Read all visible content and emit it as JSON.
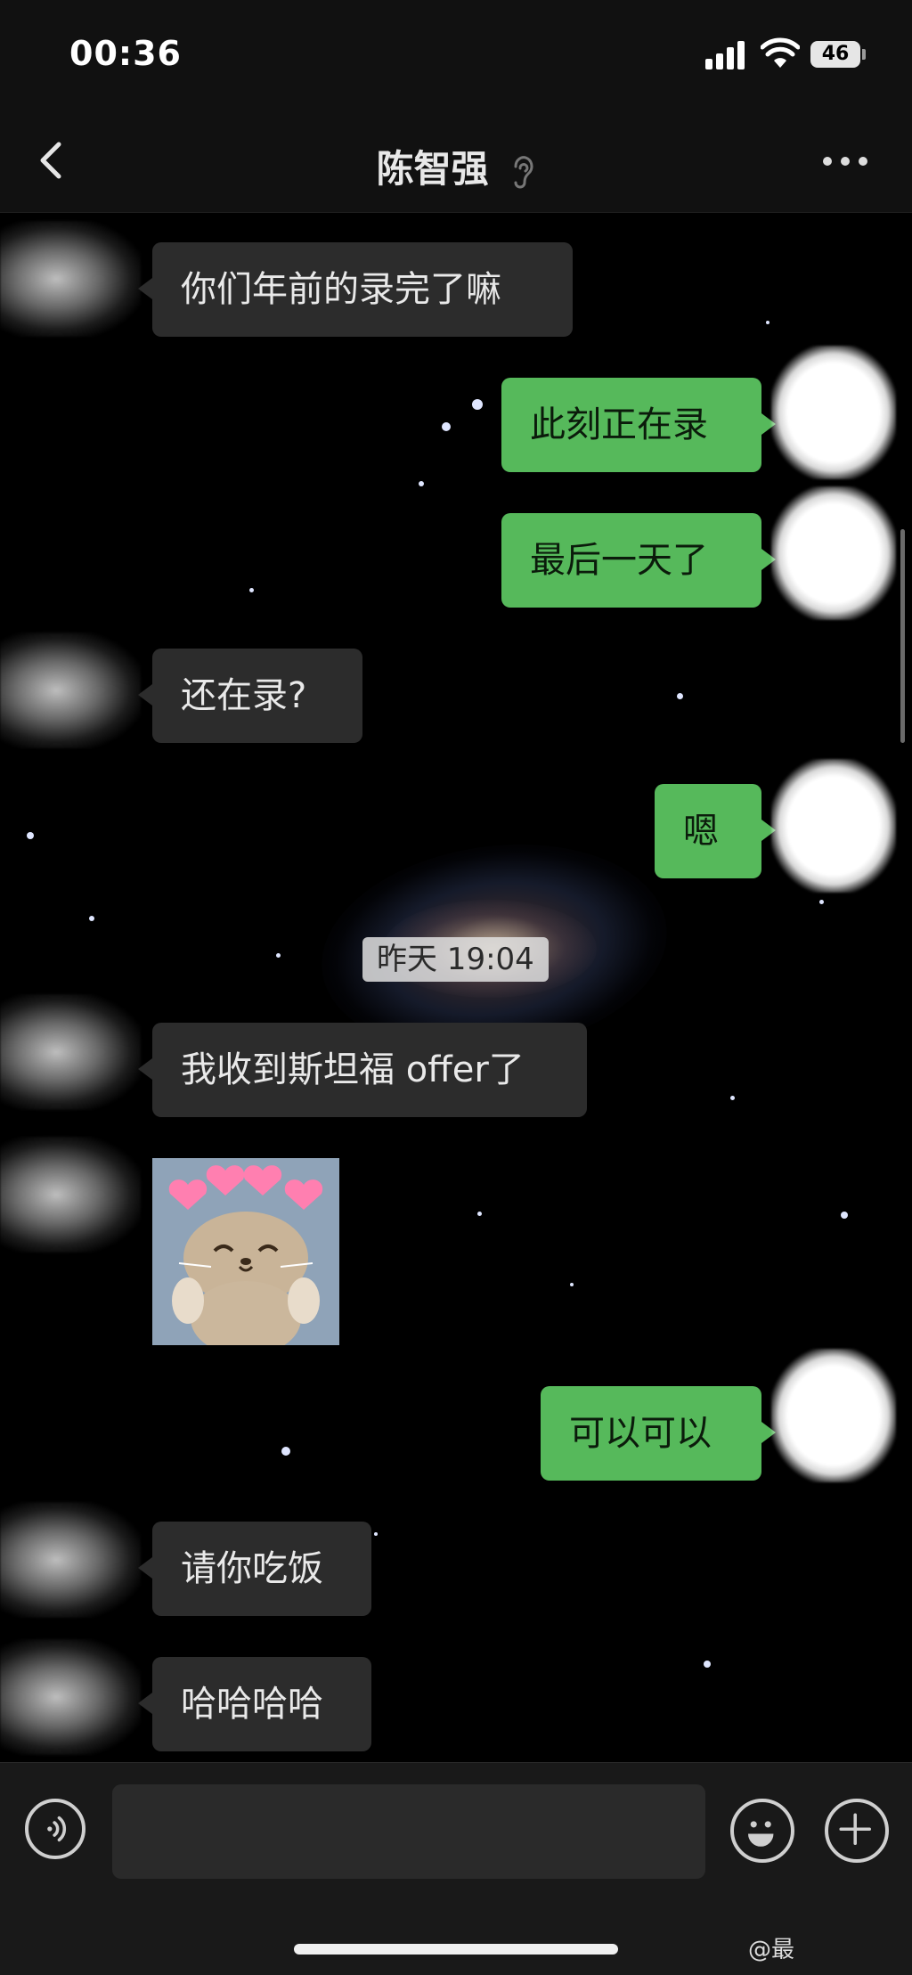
{
  "status_bar": {
    "time": "00:36",
    "battery": "46"
  },
  "nav": {
    "title": "陈智强"
  },
  "messages": [
    {
      "side": "left",
      "text": "你们年前的录完了嘛"
    },
    {
      "side": "right",
      "text": "此刻正在录"
    },
    {
      "side": "right",
      "text": "最后一天了"
    },
    {
      "side": "left",
      "text": "还在录?"
    },
    {
      "side": "right",
      "text": "嗯"
    },
    {
      "side": "left",
      "text": "我收到斯坦福 offer了"
    },
    {
      "side": "left",
      "type": "sticker",
      "description": "otter-hearts-sticker"
    },
    {
      "side": "right",
      "text": "可以可以"
    },
    {
      "side": "left",
      "text": "请你吃饭"
    },
    {
      "side": "left",
      "text": "哈哈哈哈"
    }
  ],
  "timestamp": "昨天 19:04",
  "input": {
    "placeholder": ""
  },
  "watermark": "@最",
  "icons": {
    "back": "chevron-left-icon",
    "ear": "ear-icon",
    "more": "more-dots-icon",
    "voice": "voice-icon",
    "emoji": "emoji-icon",
    "plus": "plus-icon"
  },
  "colors": {
    "bubble_mine": "#56b95b",
    "bubble_other": "#2c2c2c",
    "background": "#000000"
  }
}
